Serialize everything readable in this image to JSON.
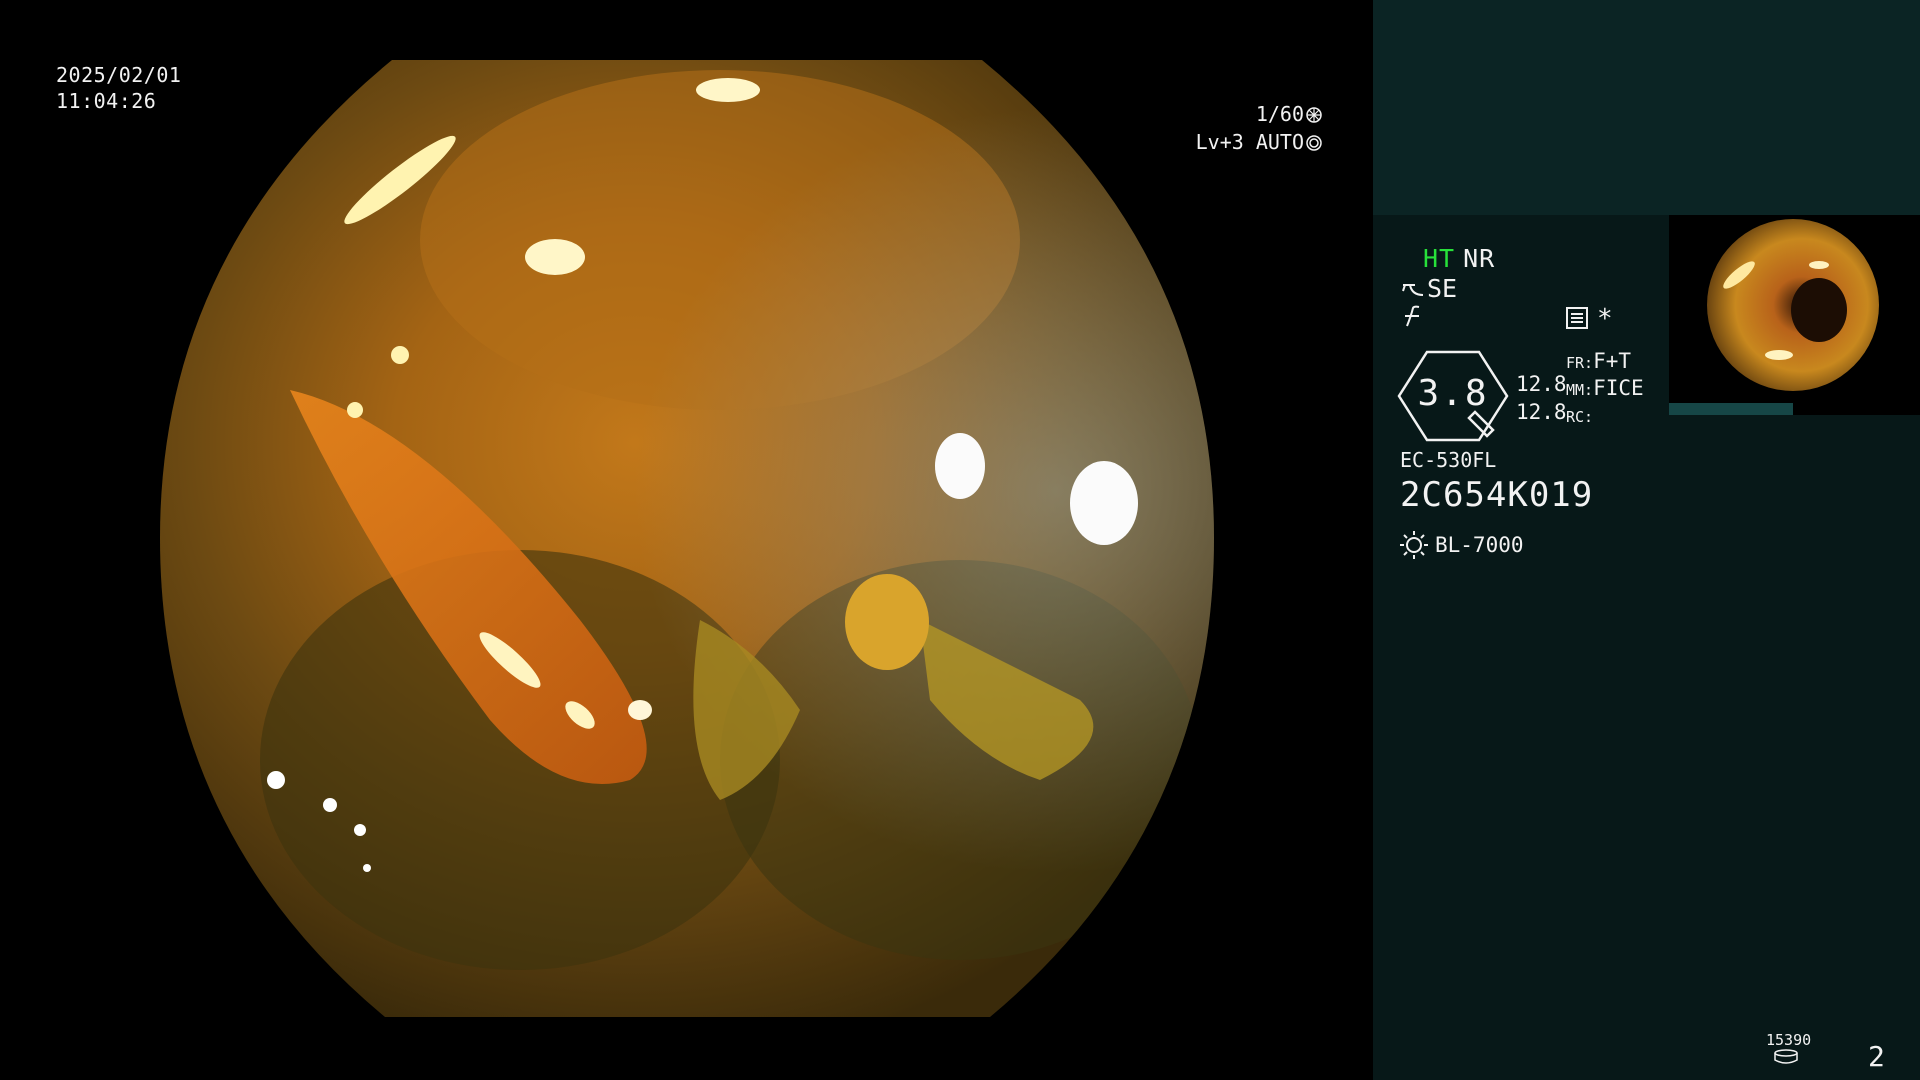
{
  "datetime": {
    "date": "2025/02/01",
    "time": "11:04:26"
  },
  "exposure": {
    "shutter": "1/60",
    "level": "Lv+3 AUTO"
  },
  "status": {
    "ht_label": "HT",
    "nr_label": "NR",
    "se_label": "SE",
    "star_label": "*",
    "zoom_value": "3.8",
    "readings": [
      "12.8",
      "12.8"
    ],
    "fr_key": "FR:",
    "fr_value": "F+T",
    "mm_key": "MM:",
    "mm_value": "FICE",
    "rc_key": "RC:",
    "rc_value": ""
  },
  "scope": {
    "model": "EC-530FL",
    "serial": "2C654K019"
  },
  "light_source": {
    "model": "BL-7000"
  },
  "footer": {
    "image_count": "15390",
    "page_number": "2"
  },
  "colors": {
    "ht_green": "#27e03a",
    "panel_dark": "#071818",
    "panel_top": "#0b2424",
    "thumb_bar": "#164646"
  },
  "icons": [
    "shutter-icon",
    "auto-iris-icon",
    "structure-enhance-icon",
    "color-enhance-icon",
    "menu-icon",
    "zoom-indicator-icon",
    "light-source-icon",
    "disk-icon"
  ]
}
